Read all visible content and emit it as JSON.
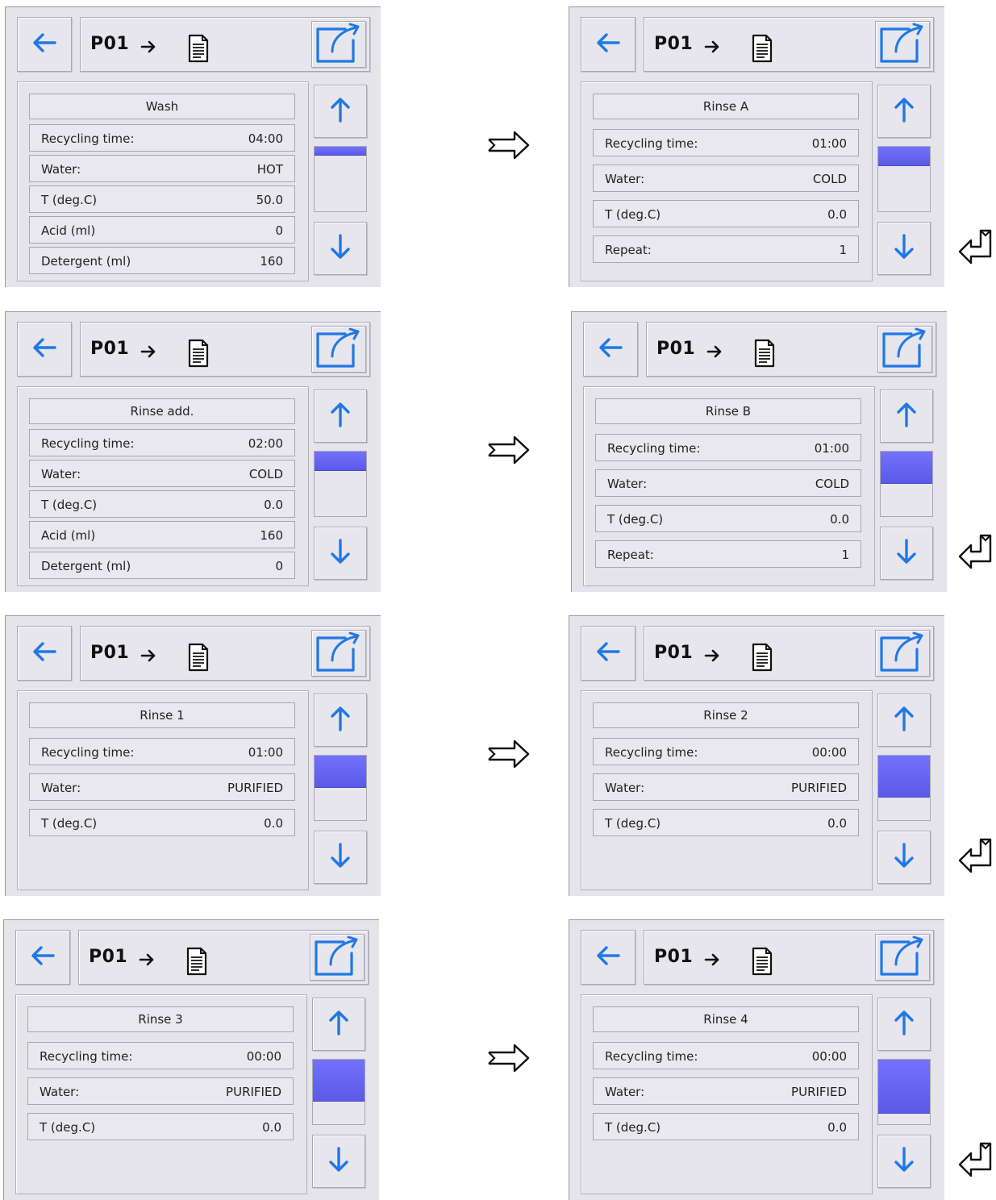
{
  "header": {
    "program": "P01"
  },
  "icons": {
    "back": "back-arrow-icon",
    "doc": "document-icon",
    "export": "export-icon",
    "up": "up-arrow-icon",
    "down": "down-arrow-icon",
    "flow": "right-double-arrow-icon",
    "return": "return-arrow-icon"
  },
  "colors": {
    "accent": "#1f78e6",
    "thumb": "#6464f5",
    "panel": "#e4e4ea"
  },
  "screens": [
    {
      "title": "Wash",
      "scroll_fraction": 0.12,
      "rows": [
        {
          "label": "Recycling time:",
          "value": "04:00"
        },
        {
          "label": "Water:",
          "value": "HOT"
        },
        {
          "label": "T (deg.C)",
          "value": "50.0"
        },
        {
          "label": "Acid (ml)",
          "value": "0"
        },
        {
          "label": "Detergent (ml)",
          "value": "160"
        }
      ]
    },
    {
      "title": "Rinse A",
      "scroll_fraction": 0.28,
      "rows": [
        {
          "label": "Recycling time:",
          "value": "01:00"
        },
        {
          "label": "Water:",
          "value": "COLD"
        },
        {
          "label": "T (deg.C)",
          "value": "0.0"
        },
        {
          "label": "Repeat:",
          "value": "1"
        }
      ]
    },
    {
      "title": "Rinse add.",
      "scroll_fraction": 0.28,
      "rows": [
        {
          "label": "Recycling time:",
          "value": "02:00"
        },
        {
          "label": "Water:",
          "value": "COLD"
        },
        {
          "label": "T (deg.C)",
          "value": "0.0"
        },
        {
          "label": "Acid (ml)",
          "value": "160"
        },
        {
          "label": "Detergent (ml)",
          "value": "0"
        }
      ]
    },
    {
      "title": "Rinse B",
      "scroll_fraction": 0.48,
      "rows": [
        {
          "label": "Recycling time:",
          "value": "01:00"
        },
        {
          "label": "Water:",
          "value": "COLD"
        },
        {
          "label": "T (deg.C)",
          "value": "0.0"
        },
        {
          "label": "Repeat:",
          "value": "1"
        }
      ]
    },
    {
      "title": "Rinse 1",
      "scroll_fraction": 0.48,
      "rows": [
        {
          "label": "Recycling time:",
          "value": "01:00"
        },
        {
          "label": "Water:",
          "value": "PURIFIED"
        },
        {
          "label": "T (deg.C)",
          "value": "0.0"
        }
      ]
    },
    {
      "title": "Rinse 2",
      "scroll_fraction": 0.62,
      "rows": [
        {
          "label": "Recycling time:",
          "value": "00:00"
        },
        {
          "label": "Water:",
          "value": "PURIFIED"
        },
        {
          "label": "T (deg.C)",
          "value": "0.0"
        }
      ]
    },
    {
      "title": "Rinse 3",
      "scroll_fraction": 0.62,
      "rows": [
        {
          "label": "Recycling time:",
          "value": "00:00"
        },
        {
          "label": "Water:",
          "value": "PURIFIED"
        },
        {
          "label": "T (deg.C)",
          "value": "0.0"
        }
      ]
    },
    {
      "title": "Rinse 4",
      "scroll_fraction": 0.8,
      "rows": [
        {
          "label": "Recycling time:",
          "value": "00:00"
        },
        {
          "label": "Water:",
          "value": "PURIFIED"
        },
        {
          "label": "T (deg.C)",
          "value": "0.0"
        }
      ]
    }
  ]
}
